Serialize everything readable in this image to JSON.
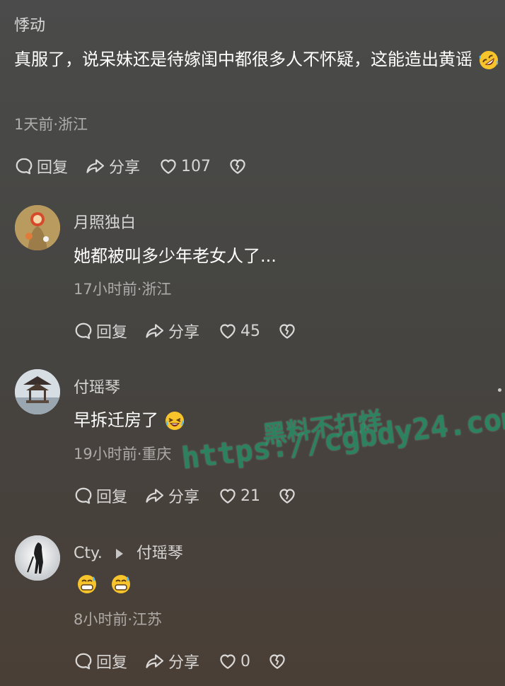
{
  "comment_main": {
    "author": "悸动",
    "text": "真服了，说呆妹还是待嫁闺中都很多人不怀疑，这能造出黄谣",
    "meta": "1天前·浙江",
    "reply_label": "回复",
    "share_label": "分享",
    "likes": "107"
  },
  "replies": [
    {
      "author": "月照独白",
      "text": "她都被叫多少年老女人了...",
      "meta": "17小时前·浙江",
      "reply_label": "回复",
      "share_label": "分享",
      "likes": "45"
    },
    {
      "author": "付瑶琴",
      "text": "早拆迁房了",
      "meta": "19小时前·重庆",
      "reply_label": "回复",
      "share_label": "分享",
      "likes": "21"
    },
    {
      "author": "Cty.",
      "reply_to": "付瑶琴",
      "text": "",
      "meta": "8小时前·江苏",
      "reply_label": "回复",
      "share_label": "分享",
      "likes": "0"
    }
  ],
  "watermark": {
    "line1": "黑料不打烊",
    "line2": "https://cgbdy24.com"
  },
  "icons": {
    "comment": "comment-bubble-icon",
    "share": "share-arrow-icon",
    "like": "heart-outline-icon",
    "dislike": "broken-heart-icon"
  },
  "colors": {
    "watermark": "#2a8a63"
  }
}
